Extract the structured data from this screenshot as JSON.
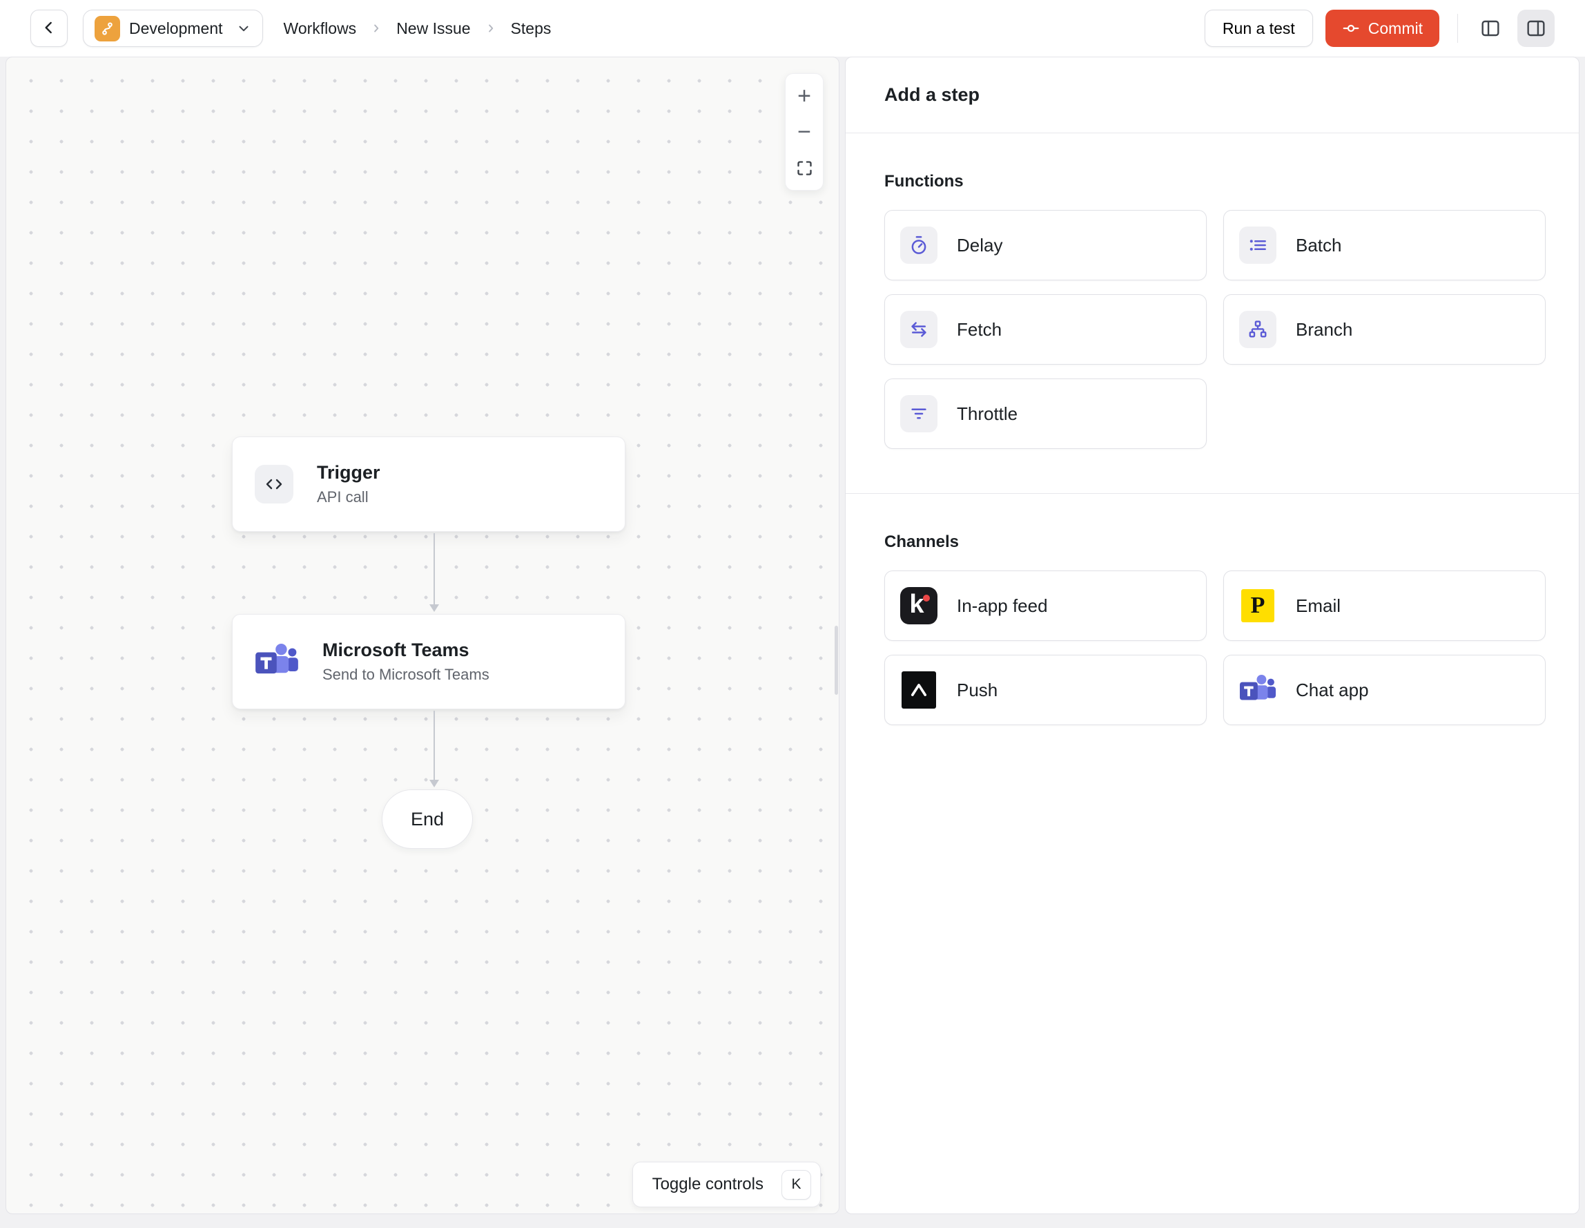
{
  "topbar": {
    "environment": {
      "label": "Development",
      "icon": "knock-environment-icon"
    },
    "breadcrumb": {
      "items": [
        "Workflows",
        "New Issue",
        "Steps"
      ]
    },
    "run_test_label": "Run a test",
    "commit_label": "Commit"
  },
  "canvas": {
    "nodes": {
      "trigger": {
        "title": "Trigger",
        "subtitle": "API call",
        "icon": "code-icon"
      },
      "teams": {
        "title": "Microsoft Teams",
        "subtitle": "Send to Microsoft Teams",
        "icon": "microsoft-teams-icon"
      },
      "end": {
        "label": "End"
      }
    },
    "zoom_controls": {
      "zoom_in": "+",
      "zoom_out": "−"
    },
    "toggle_controls": {
      "label": "Toggle controls",
      "shortcut": "K"
    }
  },
  "panel": {
    "title": "Add a step",
    "functions": {
      "label": "Functions",
      "items": [
        {
          "label": "Delay",
          "icon": "stopwatch-icon"
        },
        {
          "label": "Batch",
          "icon": "list-icon"
        },
        {
          "label": "Fetch",
          "icon": "swap-arrows-icon"
        },
        {
          "label": "Branch",
          "icon": "tree-icon"
        },
        {
          "label": "Throttle",
          "icon": "funnel-icon"
        }
      ]
    },
    "channels": {
      "label": "Channels",
      "items": [
        {
          "label": "In-app feed",
          "icon": "knock-logo-icon",
          "icon_letter": "k"
        },
        {
          "label": "Email",
          "icon": "postmark-logo-icon",
          "icon_letter": "P"
        },
        {
          "label": "Push",
          "icon": "expo-logo-icon"
        },
        {
          "label": "Chat app",
          "icon": "microsoft-teams-icon"
        }
      ]
    }
  },
  "colors": {
    "commit_button": "#E5492E",
    "function_icon": "#5B5BD6",
    "environment_icon_bg": "#EDA23D",
    "knock_logo_bg": "#1A1A1E",
    "knock_logo_dot": "#EB4747",
    "postmark_logo_bg": "#FFDE00",
    "expo_logo_bg": "#0C0D0E",
    "teams_dark": "#4B53BC",
    "teams_mid": "#7B83EB",
    "teams_light": "#5059C9",
    "edge_line": "#C6C9D0"
  }
}
